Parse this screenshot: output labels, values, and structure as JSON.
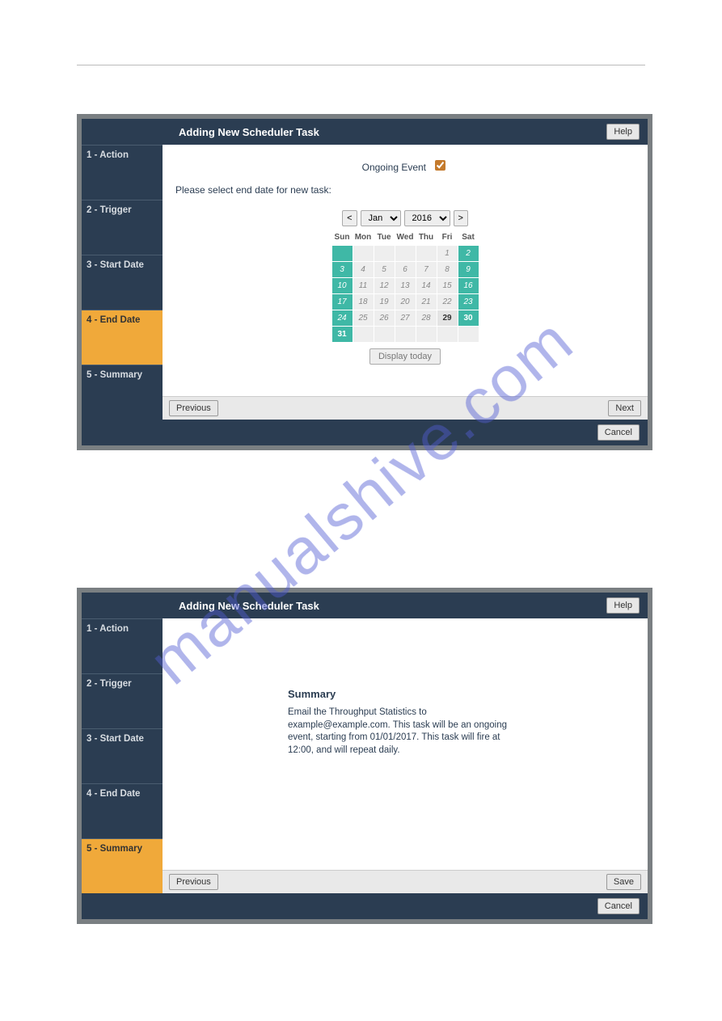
{
  "modal1": {
    "title": "Adding New Scheduler Task",
    "help": "Help",
    "steps": [
      "1 - Action",
      "2 - Trigger",
      "3 - Start Date",
      "4 - End Date",
      "5 - Summary"
    ],
    "activeIndex": 3,
    "ongoingLabel": "Ongoing Event",
    "ongoingChecked": true,
    "instruction": "Please select end date for new task:",
    "cal": {
      "prev": "<",
      "next": ">",
      "month": "Jan",
      "year": "2016",
      "dow": [
        "Sun",
        "Mon",
        "Tue",
        "Wed",
        "Thu",
        "Fri",
        "Sat"
      ],
      "weeks": [
        [
          {
            "d": "",
            "c": "teal"
          },
          {
            "d": "",
            "c": ""
          },
          {
            "d": "",
            "c": ""
          },
          {
            "d": "",
            "c": ""
          },
          {
            "d": "",
            "c": ""
          },
          {
            "d": "1",
            "c": ""
          },
          {
            "d": "2",
            "c": "teal"
          }
        ],
        [
          {
            "d": "3",
            "c": "teal"
          },
          {
            "d": "4",
            "c": ""
          },
          {
            "d": "5",
            "c": ""
          },
          {
            "d": "6",
            "c": ""
          },
          {
            "d": "7",
            "c": ""
          },
          {
            "d": "8",
            "c": ""
          },
          {
            "d": "9",
            "c": "teal"
          }
        ],
        [
          {
            "d": "10",
            "c": "teal"
          },
          {
            "d": "11",
            "c": ""
          },
          {
            "d": "12",
            "c": ""
          },
          {
            "d": "13",
            "c": ""
          },
          {
            "d": "14",
            "c": ""
          },
          {
            "d": "15",
            "c": ""
          },
          {
            "d": "16",
            "c": "teal"
          }
        ],
        [
          {
            "d": "17",
            "c": "teal"
          },
          {
            "d": "18",
            "c": ""
          },
          {
            "d": "19",
            "c": ""
          },
          {
            "d": "20",
            "c": ""
          },
          {
            "d": "21",
            "c": ""
          },
          {
            "d": "22",
            "c": ""
          },
          {
            "d": "23",
            "c": "teal"
          }
        ],
        [
          {
            "d": "24",
            "c": "teal"
          },
          {
            "d": "25",
            "c": ""
          },
          {
            "d": "26",
            "c": ""
          },
          {
            "d": "27",
            "c": ""
          },
          {
            "d": "28",
            "c": ""
          },
          {
            "d": "29",
            "c": "enabled"
          },
          {
            "d": "30",
            "c": "enabled teal"
          }
        ],
        [
          {
            "d": "31",
            "c": "enabled teal"
          },
          {
            "d": "",
            "c": ""
          },
          {
            "d": "",
            "c": ""
          },
          {
            "d": "",
            "c": ""
          },
          {
            "d": "",
            "c": ""
          },
          {
            "d": "",
            "c": ""
          },
          {
            "d": "",
            "c": ""
          }
        ]
      ],
      "displayToday": "Display today"
    },
    "prev": "Previous",
    "next": "Next",
    "cancel": "Cancel"
  },
  "modal2": {
    "title": "Adding New Scheduler Task",
    "help": "Help",
    "steps": [
      "1 - Action",
      "2 - Trigger",
      "3 - Start Date",
      "4 - End Date",
      "5 - Summary"
    ],
    "activeIndex": 4,
    "summaryHeading": "Summary",
    "summaryText": "Email the Throughput Statistics to example@example.com. This task will be an ongoing event, starting from 01/01/2017. This task will fire at 12:00, and will repeat daily.",
    "prev": "Previous",
    "save": "Save",
    "cancel": "Cancel"
  },
  "watermark": "manualshive.com"
}
